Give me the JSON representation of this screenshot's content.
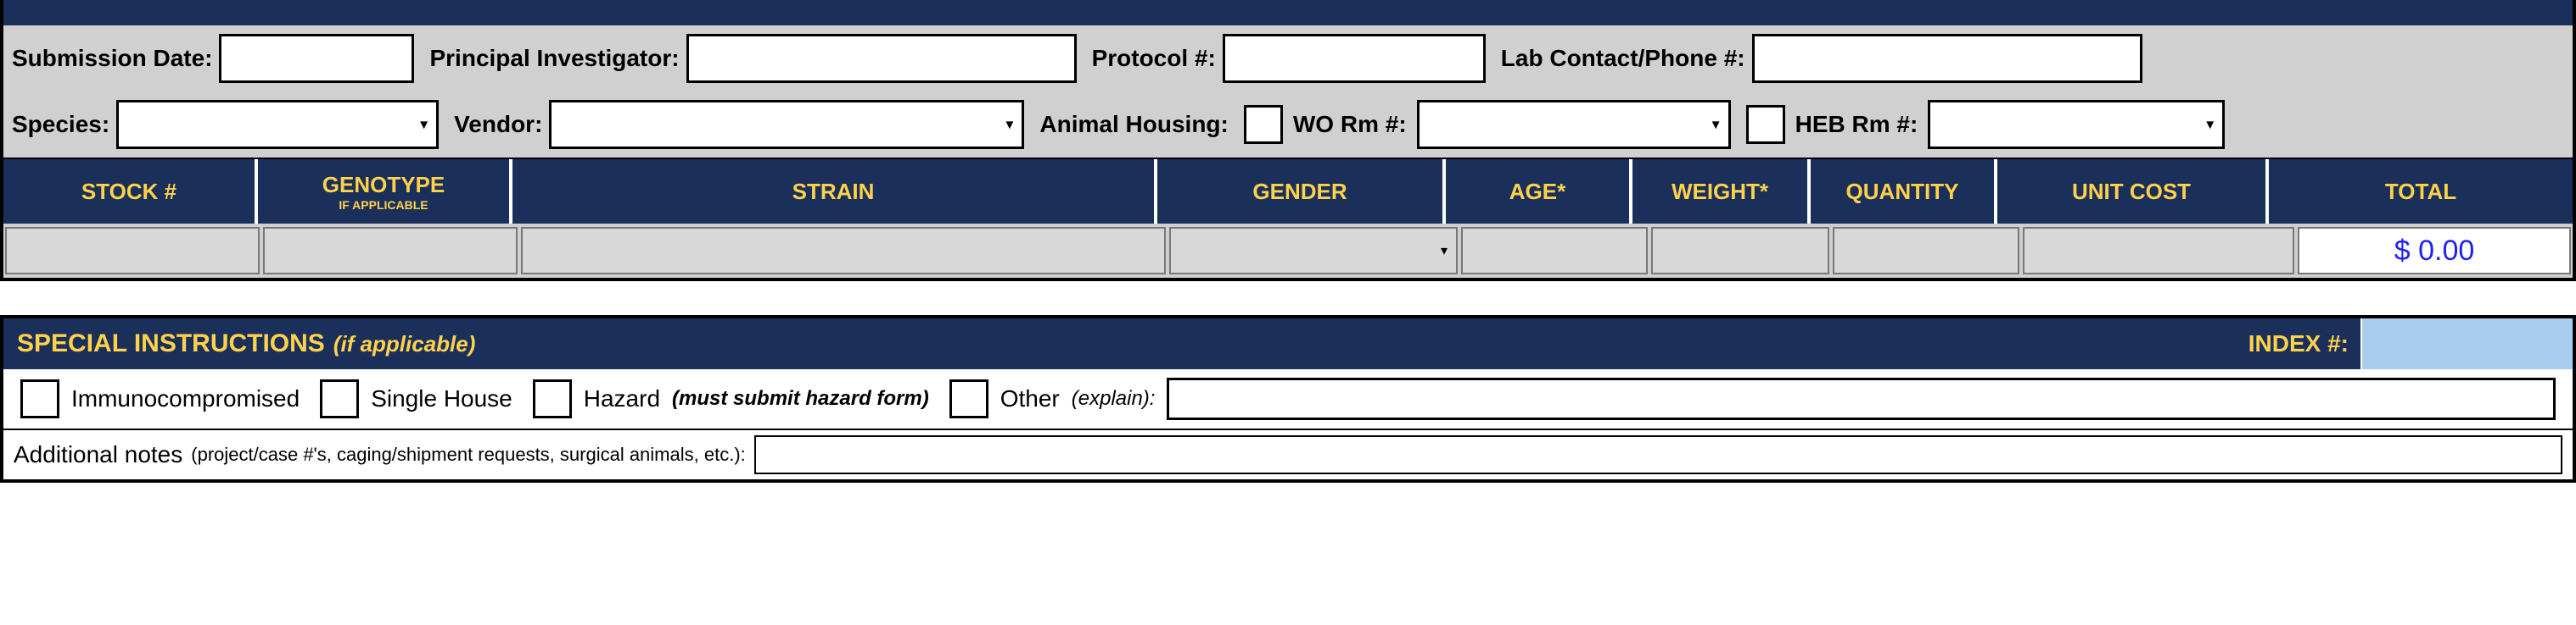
{
  "form": {
    "submission_date_label": "Submission Date:",
    "submission_date_value": "",
    "pi_label": "Principal Investigator:",
    "pi_value": "",
    "protocol_label": "Protocol #:",
    "protocol_value": "",
    "lab_contact_label": "Lab Contact/Phone #:",
    "lab_contact_value": "",
    "species_label": "Species:",
    "species_value": "",
    "vendor_label": "Vendor:",
    "vendor_value": "",
    "animal_housing_label": "Animal Housing:",
    "wo_rm_label": "WO Rm #:",
    "wo_rm_value": "",
    "heb_rm_label": "HEB Rm #:",
    "heb_rm_value": ""
  },
  "table": {
    "headers": {
      "stock": "STOCK #",
      "genotype": "GENOTYPE",
      "genotype_sub": "IF APPLICABLE",
      "strain": "STRAIN",
      "gender": "GENDER",
      "age": "AGE*",
      "weight": "WEIGHT*",
      "quantity": "QUANTITY",
      "unit_cost": "UNIT COST",
      "total": "TOTAL"
    },
    "rows": [
      {
        "stock": "",
        "genotype": "",
        "strain": "",
        "gender": "",
        "age": "",
        "weight": "",
        "quantity": "",
        "unit_cost": "",
        "total": "$ 0.00"
      }
    ]
  },
  "special": {
    "title": "SPECIAL INSTRUCTIONS",
    "title_sub": "(if applicable)",
    "index_label": "INDEX #:",
    "index_value": "",
    "options": {
      "immuno": "Immunocompromised",
      "single_house": "Single House",
      "hazard": "Hazard",
      "hazard_sub": "(must submit hazard form)",
      "other": "Other",
      "other_sub": "(explain)"
    },
    "other_value": "",
    "notes_label": "Additional notes",
    "notes_sub": "(project/case #'s, caging/shipment requests, surgical animals, etc.):",
    "notes_value": ""
  }
}
